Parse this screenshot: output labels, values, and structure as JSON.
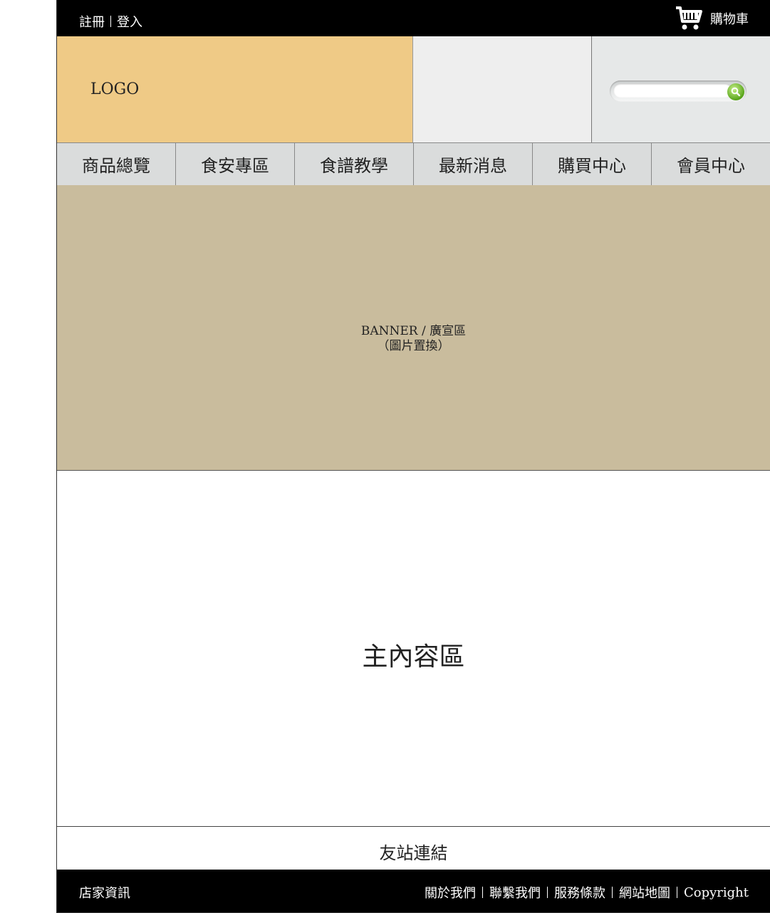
{
  "topbar": {
    "register": "註冊",
    "login": "登入",
    "cart_label": "購物車"
  },
  "header": {
    "logo": "LOGO",
    "search": {
      "placeholder": ""
    }
  },
  "nav": {
    "items": [
      "商品總覽",
      "食安專區",
      "食譜教學",
      "最新消息",
      "購買中心",
      "會員中心"
    ]
  },
  "banner": {
    "line1": "BANNER / 廣宣區",
    "line2": "（圖片置換）"
  },
  "main": {
    "label": "主內容區"
  },
  "friend_links": {
    "label": "友站連結"
  },
  "footer": {
    "shop_info": "店家資訊",
    "links": [
      "關於我們",
      "聯繫我們",
      "服務條款",
      "網站地圖",
      "Copyright"
    ]
  },
  "colors": {
    "topbar_bg": "#000000",
    "logo_bg": "#efca86",
    "nav_bg": "#dadcdc",
    "banner_bg": "#c9bc9d",
    "search_button": "#59a51b"
  },
  "icons": {
    "cart": "cart-icon",
    "search": "search-icon"
  }
}
